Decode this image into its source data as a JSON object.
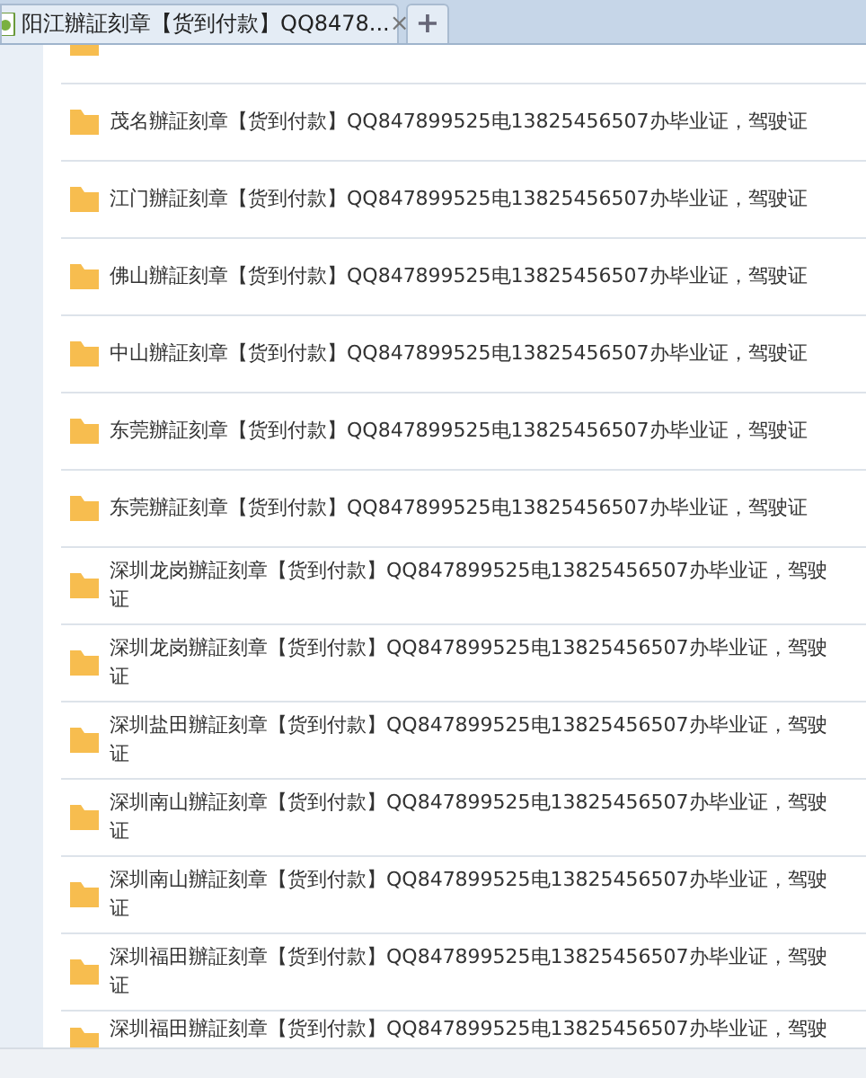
{
  "tab": {
    "title": "阳江辦証刻章【货到付款】QQ8478...",
    "close": "×",
    "new_tab": "+"
  },
  "threads": [
    {
      "title": "茂名辦証刻章【货到付款】QQ847899525电13825456507办毕业证，驾驶证"
    },
    {
      "title": "江门辦証刻章【货到付款】QQ847899525电13825456507办毕业证，驾驶证"
    },
    {
      "title": "佛山辦証刻章【货到付款】QQ847899525电13825456507办毕业证，驾驶证"
    },
    {
      "title": "中山辦証刻章【货到付款】QQ847899525电13825456507办毕业证，驾驶证"
    },
    {
      "title": "东莞辦証刻章【货到付款】QQ847899525电13825456507办毕业证，驾驶证"
    },
    {
      "title": "东莞辦証刻章【货到付款】QQ847899525电13825456507办毕业证，驾驶证"
    },
    {
      "title": "深圳龙岗辦証刻章【货到付款】QQ847899525电13825456507办毕业证，驾驶证"
    },
    {
      "title": "深圳龙岗辦証刻章【货到付款】QQ847899525电13825456507办毕业证，驾驶证"
    },
    {
      "title": "深圳盐田辦証刻章【货到付款】QQ847899525电13825456507办毕业证，驾驶证"
    },
    {
      "title": "深圳南山辦証刻章【货到付款】QQ847899525电13825456507办毕业证，驾驶证"
    },
    {
      "title": "深圳南山辦証刻章【货到付款】QQ847899525电13825456507办毕业证，驾驶证"
    },
    {
      "title": "深圳福田辦証刻章【货到付款】QQ847899525电13825456507办毕业证，驾驶证"
    },
    {
      "title": "深圳福田辦証刻章【货到付款】QQ847899525电13825456507办毕业证，驾驶"
    }
  ]
}
